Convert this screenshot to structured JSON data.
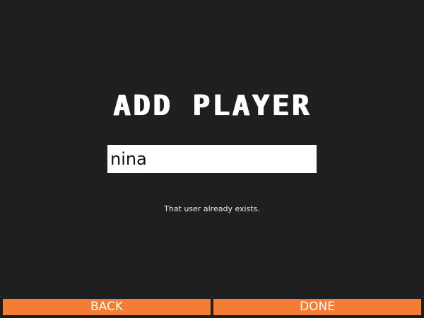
{
  "screen": {
    "title": "ADD PLAYER",
    "input_value": "nina",
    "message": "That user already exists."
  },
  "buttons": {
    "back_label": "BACK",
    "done_label": "DONE"
  },
  "colors": {
    "background": "#1f1f1f",
    "accent": "#f47c34",
    "text": "#ffffff"
  }
}
